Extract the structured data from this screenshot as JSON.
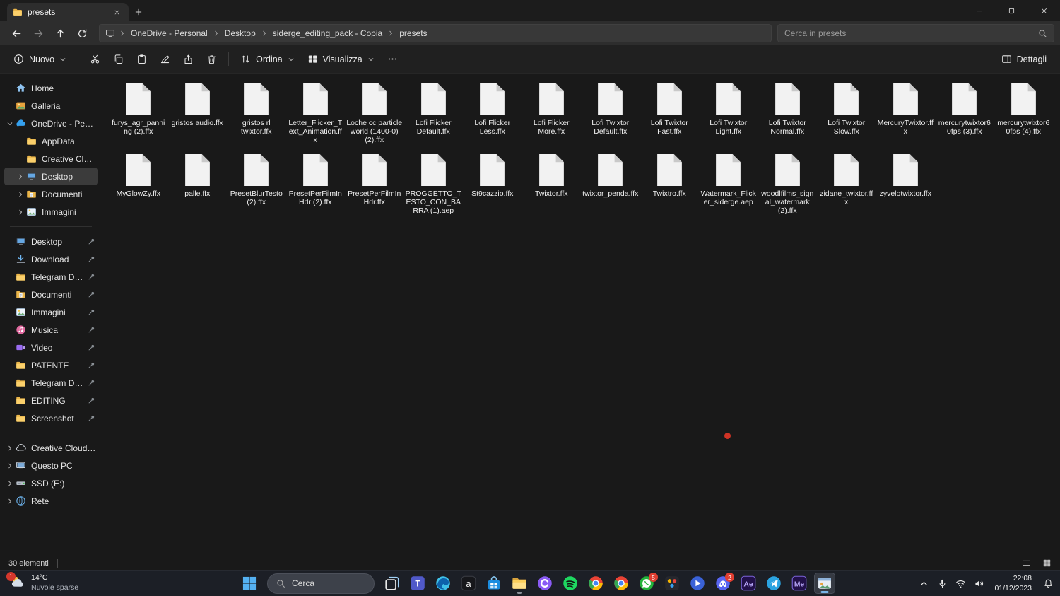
{
  "window": {
    "tab_title": "presets"
  },
  "navbar": {
    "breadcrumb": [
      "OneDrive - Personal",
      "Desktop",
      "siderge_editing_pack - Copia",
      "presets"
    ],
    "search_placeholder": "Cerca in presets"
  },
  "toolbar": {
    "new_label": "Nuovo",
    "sort_label": "Ordina",
    "view_label": "Visualizza",
    "details_label": "Dettagli"
  },
  "sidebar": {
    "sections": [
      {
        "name": "primary",
        "items": [
          {
            "label": "Home",
            "icon": "home"
          },
          {
            "label": "Galleria",
            "icon": "gallery"
          },
          {
            "label": "OneDrive - Personal",
            "icon": "onedrive",
            "chevron": "down"
          },
          {
            "label": "AppData",
            "icon": "folder",
            "indent": 1
          },
          {
            "label": "Creative Cloud Files",
            "icon": "folder",
            "indent": 1
          },
          {
            "label": "Desktop",
            "icon": "desktop",
            "indent": 1,
            "chevron": "right",
            "selected": true
          },
          {
            "label": "Documenti",
            "icon": "documents",
            "indent": 1,
            "chevron": "right"
          },
          {
            "label": "Immagini",
            "icon": "pictures",
            "indent": 1,
            "chevron": "right"
          }
        ]
      },
      {
        "name": "pinned",
        "items": [
          {
            "label": "Desktop",
            "icon": "desktop",
            "pin": true
          },
          {
            "label": "Download",
            "icon": "download",
            "pin": true
          },
          {
            "label": "Telegram Desktop",
            "icon": "folder",
            "pin": true
          },
          {
            "label": "Documenti",
            "icon": "documents",
            "pin": true
          },
          {
            "label": "Immagini",
            "icon": "pictures",
            "pin": true
          },
          {
            "label": "Musica",
            "icon": "music",
            "pin": true
          },
          {
            "label": "Video",
            "icon": "video",
            "pin": true
          },
          {
            "label": "PATENTE",
            "icon": "folder",
            "pin": true
          },
          {
            "label": "Telegram Desktop",
            "icon": "folder",
            "pin": true
          },
          {
            "label": "EDITING",
            "icon": "folder",
            "pin": true
          },
          {
            "label": "Screenshot",
            "icon": "folder",
            "pin": true
          }
        ]
      },
      {
        "name": "system",
        "items": [
          {
            "label": "Creative Cloud Files",
            "icon": "cloud",
            "chevron": "right"
          },
          {
            "label": "Questo PC",
            "icon": "pc",
            "chevron": "right"
          },
          {
            "label": "SSD (E:)",
            "icon": "drive",
            "chevron": "right"
          },
          {
            "label": "Rete",
            "icon": "network",
            "chevron": "right"
          }
        ]
      }
    ]
  },
  "files": {
    "row_break": 16,
    "items": [
      "furys_agr_panning (2).ffx",
      "gristos audio.ffx",
      "gristos rl twixtor.ffx",
      "Letter_Flicker_Text_Animation.ffx",
      "Loche cc particle world (1400-0) (2).ffx",
      "Lofi Flicker Default.ffx",
      "Lofi Flicker Less.ffx",
      "Lofi Flicker More.ffx",
      "Lofi Twixtor Default.ffx",
      "Lofi Twixtor Fast.ffx",
      "Lofi Twixtor Light.ffx",
      "Lofi Twixtor Normal.ffx",
      "Lofi Twixtor Slow.ffx",
      "MercuryTwixtor.ffx",
      "mercurytwixtor60fps (3).ffx",
      "mercurytwixtor60fps (4).ffx",
      "MyGlowZy.ffx",
      "palle.ffx",
      "PresetBlurTesto (2).ffx",
      "PresetPerFilmInHdr (2).ffx",
      "PresetPerFilmInHdr.ffx",
      "PROGGETTO_TESTO_CON_BARRA (1).aep",
      "St9cazzio.ffx",
      "Twixtor.ffx",
      "twixtor_penda.ffx",
      "Twixtro.ffx",
      "Watermark_Flicker_siderge.aep",
      "woodlfilms_signal_watermark (2).ffx",
      "zidane_twixtor.ffx",
      "zyvelotwixtor.ffx"
    ]
  },
  "statusbar": {
    "items_count": "30 elementi"
  },
  "taskbar": {
    "weather": {
      "temp": "14°C",
      "condition": "Nuvole sparse",
      "badge": "1"
    },
    "search_label": "Cerca",
    "apps": [
      {
        "id": "task-view"
      },
      {
        "id": "teams"
      },
      {
        "id": "edge"
      },
      {
        "id": "app-a"
      },
      {
        "id": "store"
      },
      {
        "id": "explorer",
        "running": true
      },
      {
        "id": "clipchamp"
      },
      {
        "id": "spotify"
      },
      {
        "id": "chrome"
      },
      {
        "id": "chrome-2"
      },
      {
        "id": "whatsapp",
        "badge": "5"
      },
      {
        "id": "app-colors"
      },
      {
        "id": "media-player"
      },
      {
        "id": "discord",
        "badge": "2"
      },
      {
        "id": "after-effects"
      },
      {
        "id": "telegram"
      },
      {
        "id": "media-encoder"
      },
      {
        "id": "active-app",
        "active": true,
        "running": true
      }
    ],
    "tray": [
      "chevron-up",
      "mic",
      "wifi",
      "volume"
    ],
    "clock": {
      "time": "22:08",
      "date": "01/12/2023"
    }
  }
}
